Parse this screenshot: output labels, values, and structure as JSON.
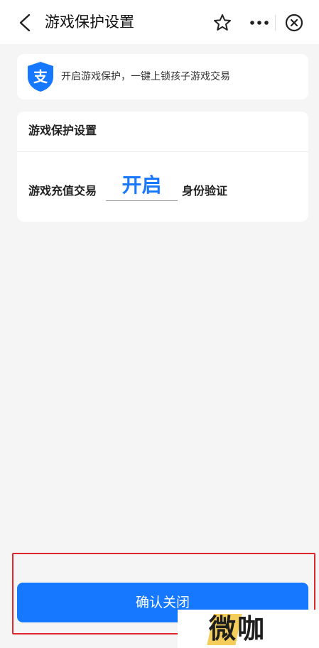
{
  "nav": {
    "title": "游戏保护设置",
    "icons": [
      "back-icon",
      "star-icon",
      "more-icon",
      "close-icon"
    ]
  },
  "banner": {
    "icon": "alipay-shield-icon",
    "icon_glyph": "支",
    "text": "开启游戏保护，一键上锁孩子游戏交易"
  },
  "card": {
    "title": "游戏保护设置",
    "row_label": "游戏充值交易",
    "blank_value": "开启",
    "row_suffix": "身份验证"
  },
  "confirm_button": {
    "label": "确认关闭"
  },
  "watermark": {
    "text": "微咖"
  },
  "colors": {
    "accent": "#1677ff",
    "highlight": "#e0262d",
    "background": "#f5f5f5",
    "card": "#ffffff"
  }
}
